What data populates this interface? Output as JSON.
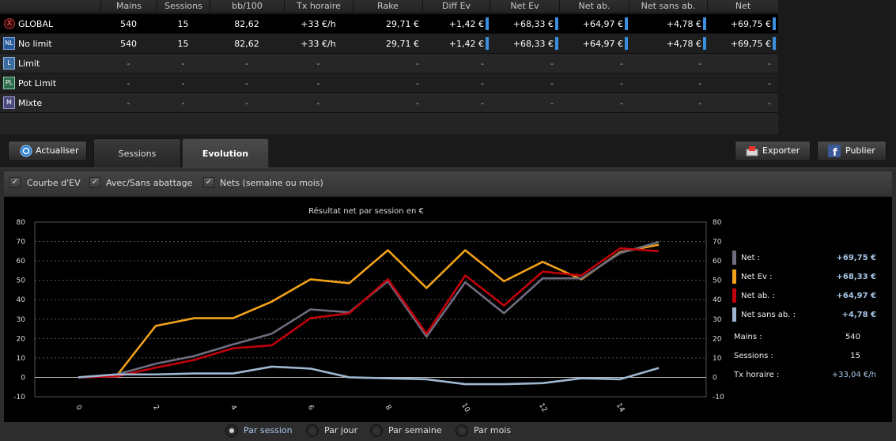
{
  "table": {
    "columns": [
      "Mains",
      "Sessions",
      "bb/100",
      "Tx horaire",
      "Rake",
      "Diff Ev",
      "Net Ev",
      "Net ab.",
      "Net sans ab.",
      "Net"
    ],
    "rows": [
      {
        "icon": "X",
        "label": "GLOBAL",
        "values": [
          "540",
          "15",
          "82,62",
          "+33 €/h",
          "29,71 €",
          "+1,42 €",
          "+68,33 €",
          "+64,97 €",
          "+4,78 €",
          "+69,75 €"
        ]
      },
      {
        "icon": "NL",
        "label": "No limit",
        "values": [
          "540",
          "15",
          "82,62",
          "+33 €/h",
          "29,71 €",
          "+1,42 €",
          "+68,33 €",
          "+64,97 €",
          "+4,78 €",
          "+69,75 €"
        ]
      },
      {
        "icon": "L",
        "label": "Limit",
        "values": [
          "-",
          "-",
          "-",
          "-",
          "-",
          "-",
          "-",
          "-",
          "-",
          "-"
        ]
      },
      {
        "icon": "PL",
        "label": "Pot Limit",
        "values": [
          "-",
          "-",
          "-",
          "-",
          "-",
          "-",
          "-",
          "-",
          "-",
          "-"
        ]
      },
      {
        "icon": "M",
        "label": "Mixte",
        "values": [
          "-",
          "-",
          "-",
          "-",
          "-",
          "-",
          "-",
          "-",
          "-",
          "-"
        ]
      }
    ]
  },
  "toolbar": {
    "refresh_label": "Actualiser",
    "tab_sessions": "Sessions",
    "tab_evolution": "Evolution",
    "export_label": "Exporter",
    "publish_label": "Publier"
  },
  "options": {
    "ev_curve": "Courbe d'EV",
    "rakeback": "Avec/Sans abattage",
    "nets": "Nets (semaine ou mois)"
  },
  "legend": [
    {
      "name": "Net :",
      "value": "+69,75 €",
      "color": "#6e6d80"
    },
    {
      "name": "Net Ev :",
      "value": "+68,33 €",
      "color": "#f2a21a"
    },
    {
      "name": "Net ab. :",
      "value": "+64,97 €",
      "color": "#c2000b"
    },
    {
      "name": "Net sans ab. :",
      "value": "+4,78 €",
      "color": "#9fb6d2"
    }
  ],
  "summary": [
    {
      "name": "Mains :",
      "value": "540"
    },
    {
      "name": "Sessions :",
      "value": "15"
    },
    {
      "name": "Tx horaire :",
      "value": "+33,04 €/h"
    }
  ],
  "grouping": {
    "by_session": "Par session",
    "by_day": "Par jour",
    "by_week": "Par semaine",
    "by_month": "Par mois",
    "selected": "by_session"
  },
  "chart_data": {
    "type": "line",
    "title": "Résultat net par session en €",
    "x": [
      0,
      1,
      2,
      3,
      4,
      5,
      6,
      7,
      8,
      9,
      10,
      11,
      12,
      13,
      14,
      15
    ],
    "x_tick_labels": [
      "0",
      "2",
      "4",
      "6",
      "8",
      "10",
      "12",
      "14"
    ],
    "x_tick_values": [
      0,
      2,
      4,
      6,
      8,
      10,
      12,
      14
    ],
    "ylim": [
      -10,
      80
    ],
    "y_ticks": [
      -10,
      0,
      10,
      20,
      30,
      40,
      50,
      60,
      70,
      80
    ],
    "grid": true,
    "legend_placement": "right",
    "series": [
      {
        "name": "Net Ev",
        "color": "#f2a21a",
        "values": [
          0,
          1,
          26.5,
          30.5,
          30.5,
          39,
          50.5,
          48.5,
          65.5,
          46,
          65.5,
          49.5,
          59.5,
          50.5,
          64.5,
          68.3
        ]
      },
      {
        "name": "Net",
        "color": "#6e6d80",
        "values": [
          0,
          1.5,
          7,
          11,
          17,
          22.5,
          35,
          33.5,
          49.5,
          21,
          49,
          33,
          51,
          51,
          64,
          69.7
        ]
      },
      {
        "name": "Net ab.",
        "color": "#c2000b",
        "values": [
          0,
          0.5,
          5,
          9,
          15,
          16.5,
          30.5,
          33,
          50.5,
          22.5,
          52.5,
          37,
          54.5,
          52.5,
          66.5,
          65
        ]
      },
      {
        "name": "Net sans ab.",
        "color": "#9fb6d2",
        "values": [
          0,
          1.5,
          1.5,
          2,
          2,
          5.5,
          4.5,
          0,
          -0.5,
          -1,
          -3.5,
          -3.5,
          -3,
          -0.5,
          -1,
          4.8
        ]
      }
    ]
  }
}
